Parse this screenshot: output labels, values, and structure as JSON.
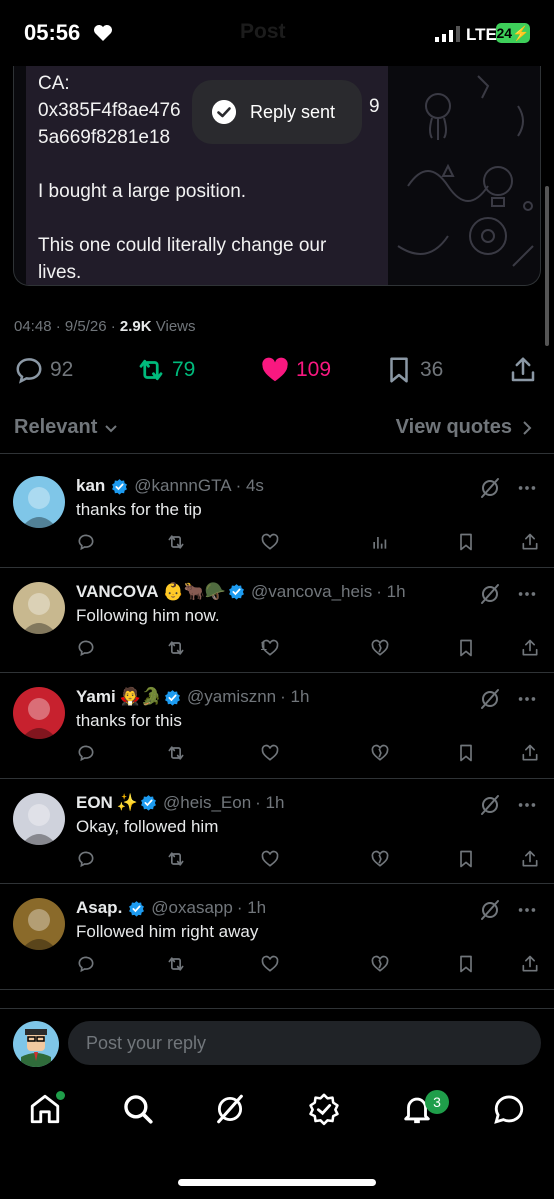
{
  "status": {
    "time": "05:56",
    "title": "Post",
    "network": "LTE",
    "battery": "24"
  },
  "media": {
    "lines": [
      "CA:",
      "0x385F4f8ae476",
      "5a669f8281e18",
      "",
      "I bought a large position.",
      "",
      "This one could literally change our",
      "lives."
    ],
    "trailing_fragment": "9"
  },
  "toast": {
    "text": "Reply sent"
  },
  "meta": {
    "time_date": "04:48 · 9/5/26 · ",
    "views_count": "2.9K",
    "views_label": " Views"
  },
  "stats": {
    "replies": "92",
    "reposts": "79",
    "likes": "109",
    "bookmarks": "36"
  },
  "colors": {
    "repost": "#00ba7c",
    "like": "#f91880",
    "verified": "#1d9bf0",
    "muted": "#71767b"
  },
  "sort": {
    "label": "Relevant",
    "quotes": "View quotes"
  },
  "replies": [
    {
      "name": "kan",
      "emoji": "",
      "handle": "@kannnGTA",
      "time": "· 4s",
      "text": "thanks for the tip",
      "like_count": "",
      "avatar_color": "#7fc6e8"
    },
    {
      "name": "VANCOVA",
      "emoji": "👶🐂🪖",
      "handle": "@vancova_heis",
      "time": "· 1h",
      "text": "Following him now.",
      "like_count": "1",
      "avatar_color": "#c8b88f"
    },
    {
      "name": "Yami",
      "emoji": "🧛🐊",
      "handle": "@yamisznn",
      "time": "· 1h",
      "text": "thanks for this",
      "like_count": "",
      "avatar_color": "#c7212e"
    },
    {
      "name": "EON",
      "emoji": "✨",
      "handle": "@heis_Eon",
      "time": "· 1h",
      "text": "Okay, followed him",
      "like_count": "",
      "avatar_color": "#cfd2dc"
    },
    {
      "name": "Asap.",
      "emoji": "",
      "handle": "@oxasapp",
      "time": "· 1h",
      "text": "Followed him right away",
      "like_count": "",
      "avatar_color": "#8a6a2a"
    }
  ],
  "composer": {
    "placeholder": "Post your reply"
  },
  "tabbar": {
    "notifications_badge": "3"
  }
}
